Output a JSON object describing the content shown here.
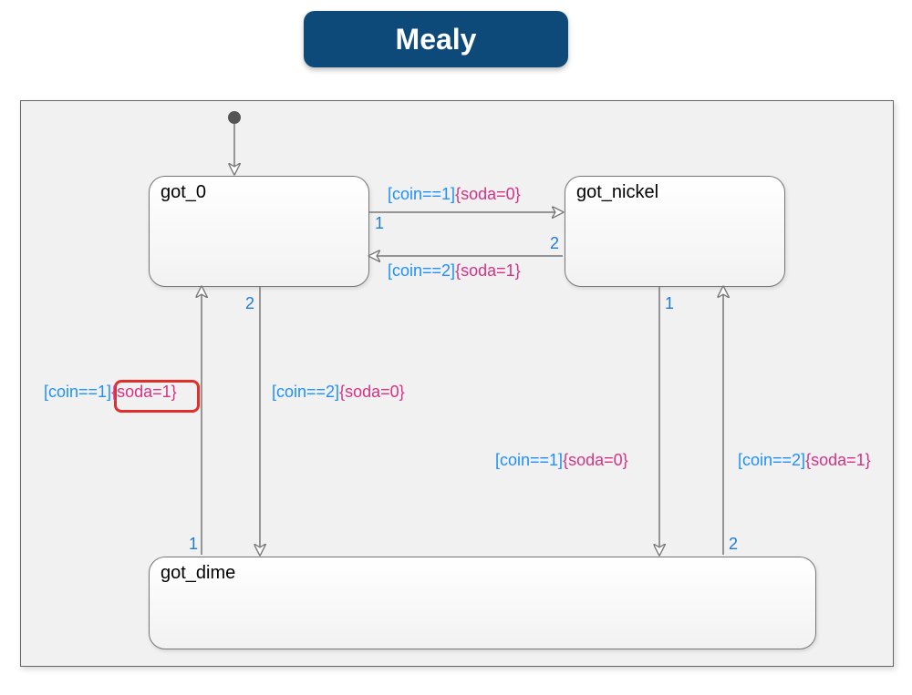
{
  "title": "Mealy",
  "states": {
    "s0": "got_0",
    "s1": "got_nickel",
    "s2": "got_dime"
  },
  "transitions": {
    "t_s0_s1": {
      "priority": "1",
      "cond": "[coin==1]",
      "act": "{soda=0}"
    },
    "t_s1_s0": {
      "priority": "2",
      "cond": "[coin==2]",
      "act": "{soda=1}"
    },
    "t_s0_s2_a": {
      "priority": "2",
      "cond": "[coin==2]",
      "act": "{soda=0}"
    },
    "t_s2_s0": {
      "priority": "1",
      "cond": "[coin==1]",
      "act": "{soda=1}"
    },
    "t_s1_s2": {
      "priority": "1",
      "cond": "[coin==1]",
      "act": "{soda=0}"
    },
    "t_s2_s1": {
      "priority": "2",
      "cond": "[coin==2]",
      "act": "{soda=1}"
    }
  },
  "highlight_target": "t_s2_s0.act"
}
